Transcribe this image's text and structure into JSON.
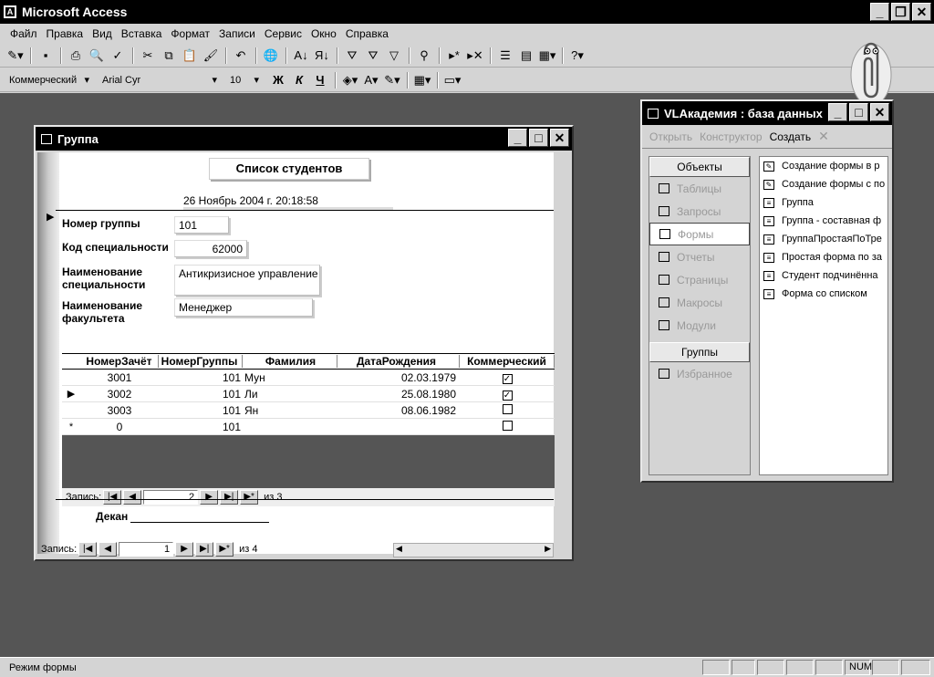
{
  "app": {
    "title": "Microsoft Access"
  },
  "menu": [
    "Файл",
    "Правка",
    "Вид",
    "Вставка",
    "Формат",
    "Записи",
    "Сервис",
    "Окно",
    "Справка"
  ],
  "format_bar": {
    "style": "Коммерческий",
    "font": "Arial Cyr",
    "size": "10",
    "bold": "Ж",
    "italic": "К",
    "underline": "Ч"
  },
  "form": {
    "window_title": "Группа",
    "header_title": "Список студентов",
    "header_date": "26 Ноябрь 2004 г. 20:18:58",
    "fields": [
      {
        "label": "Номер группы",
        "value": "101"
      },
      {
        "label": "Код специальности",
        "value": "62000"
      },
      {
        "label": "Наименование специальности",
        "value": "Антикризисное управление"
      },
      {
        "label": "Наименование факультета",
        "value": "Менеджер"
      }
    ],
    "grid": {
      "columns": [
        "НомерЗачёт",
        "НомерГруппы",
        "Фамилия",
        "ДатаРождения",
        "Коммерческий"
      ],
      "rows": [
        {
          "sel": "",
          "c1": "3001",
          "c2": "101",
          "c3": "Мун",
          "c4": "02.03.1979",
          "c5": true
        },
        {
          "sel": "▶",
          "c1": "3002",
          "c2": "101",
          "c3": "Ли",
          "c4": "25.08.1980",
          "c5": true
        },
        {
          "sel": "",
          "c1": "3003",
          "c2": "101",
          "c3": "Ян",
          "c4": "08.06.1982",
          "c5": false
        },
        {
          "sel": "*",
          "c1": "0",
          "c2": "101",
          "c3": "",
          "c4": "",
          "c5": false
        }
      ]
    },
    "subnav": {
      "label": "Запись:",
      "current": "2",
      "of": "из  3"
    },
    "footer_label": "Декан",
    "nav": {
      "label": "Запись:",
      "current": "1",
      "of": "из  4"
    }
  },
  "db": {
    "window_title": "VLАкадемия : база данных",
    "toolbar": {
      "open": "Открыть",
      "design": "Конструктор",
      "create": "Создать"
    },
    "objects_header": "Объекты",
    "objects": [
      "Таблицы",
      "Запросы",
      "Формы",
      "Отчеты",
      "Страницы",
      "Макросы",
      "Модули"
    ],
    "selected_object": "Формы",
    "groups_header": "Группы",
    "groups": [
      "Избранное"
    ],
    "items": [
      "Создание формы в р",
      "Создание формы с по",
      "Группа",
      "Группа - составная ф",
      "ГруппаПростаяПоТре",
      "Простая форма по за",
      "Студент подчинённа",
      "Форма со списком"
    ]
  },
  "status": {
    "text": "Режим формы",
    "num": "NUM"
  }
}
